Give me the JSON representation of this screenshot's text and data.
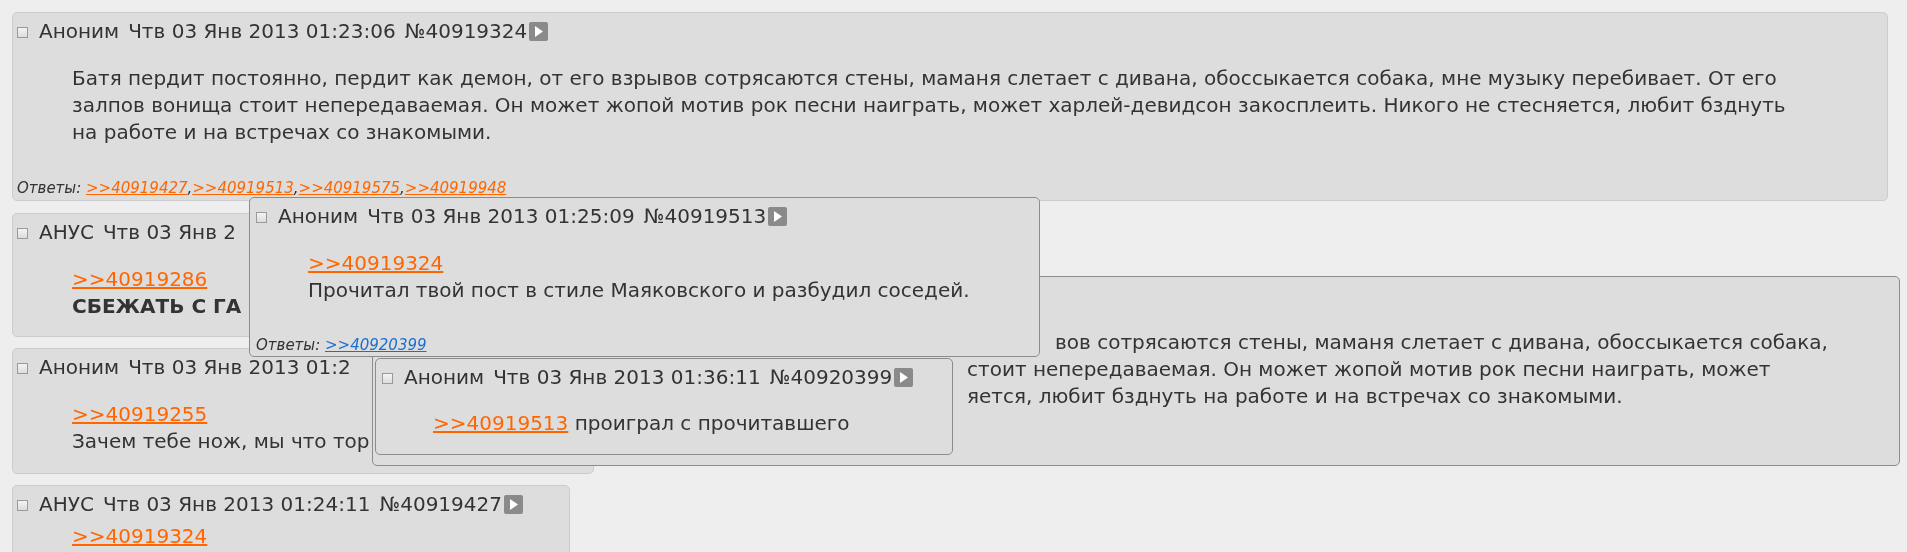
{
  "posts": [
    {
      "name": "Аноним",
      "date": "Чтв 03 Янв 2013 01:23:06",
      "number": "№40919324",
      "checked": false,
      "body": [
        [
          {
            "kind": "text",
            "text": "Батя пердит постоянно, пердит как демон, от его взрывов сотрясаются стены, маманя слетает с дивана, обоссыкается собака, мне музыку перебивает. От его\nзалпов вонища стоит непередаваемая. Он может жопой мотив рок песни наиграть, может харлей-девидсон закосплеить. Никого не стесняется, любит бзднуть\nна работе и на встречах со знакомыми."
          }
        ]
      ],
      "replies": [
        {
          "kind": "text",
          "text": "Ответы: "
        },
        {
          "kind": "link",
          "text": ">>40919427",
          "hovered": false
        },
        {
          "kind": "text",
          "text": ","
        },
        {
          "kind": "link",
          "text": ">>40919513",
          "hovered": false
        },
        {
          "kind": "text",
          "text": ","
        },
        {
          "kind": "link",
          "text": ">>40919575",
          "hovered": false
        },
        {
          "kind": "text",
          "text": ","
        },
        {
          "kind": "link",
          "text": ">>40919948",
          "hovered": false
        }
      ]
    },
    {
      "name": "АНУС",
      "date": "Чтв 03 Янв 2",
      "checked": false,
      "body": [
        [
          {
            "kind": "link",
            "text": ">>40919286",
            "hovered": false
          }
        ],
        [
          {
            "kind": "bold",
            "text": "СБЕЖАТЬ С ГА"
          }
        ]
      ]
    },
    {
      "name": "Аноним",
      "date": "Чтв 03 Янв 2013 01:2",
      "checked": false,
      "body": [
        [
          {
            "kind": "link",
            "text": ">>40919255",
            "hovered": false
          }
        ],
        [
          {
            "kind": "text",
            "text": "Зачем тебе нож, мы что тор"
          }
        ]
      ]
    },
    {
      "name": "АНУС",
      "date": "Чтв 03 Янв 2013 01:24:11",
      "number": "№40919427",
      "checked": false,
      "body": [
        [
          {
            "kind": "link",
            "text": ">>40919324",
            "hovered": false
          }
        ]
      ]
    }
  ],
  "popups": [
    {
      "visible_lines": [
        "вов сотрясаются стены, маманя слетает с дивана, обоссыкается собака,",
        "стоит непередаваемая. Он может жопой мотив рок песни наиграть, может",
        "яется, любит бзднуть на работе и на встречах со знакомыми."
      ]
    },
    {
      "name": "Аноним",
      "date": "Чтв 03 Янв 2013 01:25:09",
      "number": "№40919513",
      "checked": false,
      "body": [
        [
          {
            "kind": "link",
            "text": ">>40919324",
            "hovered": false
          }
        ],
        [
          {
            "kind": "text",
            "text": "Прочитал твой пост в стиле Маяковского и разбудил соседей."
          }
        ]
      ],
      "replies": [
        {
          "kind": "text",
          "text": "Ответы: "
        },
        {
          "kind": "link",
          "text": ">>40920399",
          "hovered": true
        }
      ]
    },
    {
      "name": "Аноним",
      "date": "Чтв 03 Янв 2013 01:36:11",
      "number": "№40920399",
      "checked": false,
      "body": [
        [
          {
            "kind": "link",
            "text": ">>40919513",
            "hovered": false
          },
          {
            "kind": "text",
            "text": " проиграл с прочитавшего"
          }
        ]
      ]
    }
  ]
}
